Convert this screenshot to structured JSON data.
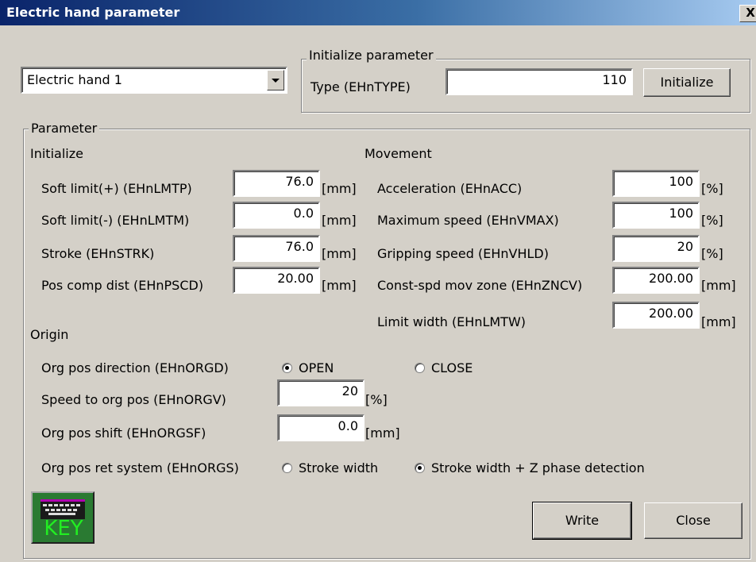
{
  "window": {
    "title": "Electric hand parameter",
    "close_glyph": "X"
  },
  "hand_select": {
    "value": "Electric hand 1"
  },
  "init_group": {
    "label": "Initialize parameter",
    "type_label": "Type (EHnTYPE)",
    "type_value": "110",
    "button": "Initialize"
  },
  "param_group": {
    "label": "Parameter",
    "initialize": {
      "heading": "Initialize",
      "rows": [
        {
          "label": "Soft limit(+) (EHnLMTP)",
          "value": "76.0",
          "unit": "[mm]"
        },
        {
          "label": "Soft limit(-) (EHnLMTM)",
          "value": "0.0",
          "unit": "[mm]"
        },
        {
          "label": "Stroke (EHnSTRK)",
          "value": "76.0",
          "unit": "[mm]"
        },
        {
          "label": "Pos comp dist (EHnPSCD)",
          "value": "20.00",
          "unit": "[mm]"
        }
      ]
    },
    "movement": {
      "heading": "Movement",
      "rows": [
        {
          "label": "Acceleration (EHnACC)",
          "value": "100",
          "unit": "[%]"
        },
        {
          "label": "Maximum speed (EHnVMAX)",
          "value": "100",
          "unit": "[%]"
        },
        {
          "label": "Gripping speed (EHnVHLD)",
          "value": "20",
          "unit": "[%]"
        },
        {
          "label": "Const-spd mov zone (EHnZNCV)",
          "value": "200.00",
          "unit": "[mm]"
        },
        {
          "label": "Limit width (EHnLMTW)",
          "value": "200.00",
          "unit": "[mm]"
        }
      ]
    },
    "origin": {
      "heading": "Origin",
      "direction_label": "Org pos direction (EHnORGD)",
      "direction_options": [
        "OPEN",
        "CLOSE"
      ],
      "direction_selected": "OPEN",
      "speed_label": "Speed to org pos (EHnORGV)",
      "speed_value": "20",
      "speed_unit": "[%]",
      "shift_label": "Org pos shift (EHnORGSF)",
      "shift_value": "0.0",
      "shift_unit": "[mm]",
      "ret_label": "Org pos ret system (EHnORGS)",
      "ret_options": [
        "Stroke width",
        "Stroke width + Z phase detection"
      ],
      "ret_selected": "Stroke width + Z phase detection"
    }
  },
  "key_button": {
    "label": "KEY",
    "icon": "keyboard-icon"
  },
  "buttons": {
    "write": "Write",
    "close": "Close"
  }
}
